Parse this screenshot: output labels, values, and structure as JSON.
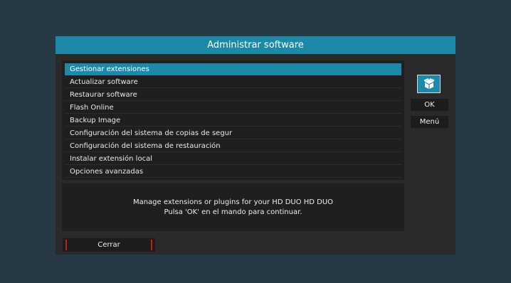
{
  "window": {
    "title": "Administrar software"
  },
  "menu": {
    "items": [
      {
        "label": "Gestionar extensiones"
      },
      {
        "label": "Actualizar software"
      },
      {
        "label": "Restaurar software"
      },
      {
        "label": "Flash Online"
      },
      {
        "label": "Backup Image"
      },
      {
        "label": "Configuración del sistema de copias de segur"
      },
      {
        "label": "Configuración del sistema de restauración"
      },
      {
        "label": "Instalar extensión local"
      },
      {
        "label": "Opciones avanzadas"
      }
    ],
    "selected_index": 0
  },
  "description": {
    "line1": "Manage extensions or plugins for your HD DUO HD DUO",
    "line2": "Pulsa 'OK' en el mando para continuar."
  },
  "side_buttons": {
    "icon": "package-icon",
    "ok_label": "OK",
    "menu_label": "Menú"
  },
  "footer": {
    "close_label": "Cerrar"
  },
  "colors": {
    "accent": "#1b8aa8",
    "background": "#263944",
    "panel": "#2a2a2a",
    "close_marker": "#c41d1d"
  }
}
